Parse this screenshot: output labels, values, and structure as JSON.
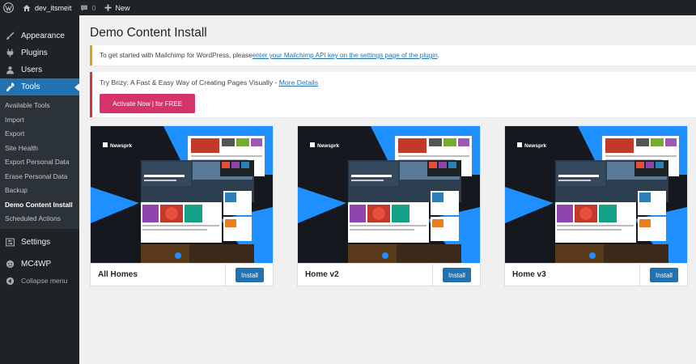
{
  "admin_bar": {
    "site_name": "dev_itsmeit",
    "comments_count": "0",
    "new_label": "New"
  },
  "sidebar": {
    "items_top": [
      {
        "label": "Appearance",
        "icon": "paintbrush-icon"
      },
      {
        "label": "Plugins",
        "icon": "plugin-icon"
      },
      {
        "label": "Users",
        "icon": "users-icon"
      }
    ],
    "current": {
      "label": "Tools",
      "icon": "wrench-icon"
    },
    "submenu": [
      "Available Tools",
      "Import",
      "Export",
      "Site Health",
      "Export Personal Data",
      "Erase Personal Data",
      "Backup",
      "Demo Content Install",
      "Scheduled Actions"
    ],
    "submenu_current": "Demo Content Install",
    "items_bottom": [
      {
        "label": "Settings",
        "icon": "settings-icon"
      },
      {
        "label": "MC4WP",
        "icon": "mc4wp-icon"
      },
      {
        "label": "Collapse menu",
        "icon": "collapse-icon"
      }
    ]
  },
  "page": {
    "title": "Demo Content Install"
  },
  "notices": {
    "mailchimp": {
      "text": "To get started with Mailchimp for WordPress, please ",
      "link": "enter your Mailchimp API key on the settings page of the plugin",
      "suffix": "."
    },
    "brizy": {
      "text": "Try Brizy: A Fast & Easy Way of Creating Pages Visually - ",
      "link": "More Details",
      "button": "Activate Now | for FREE"
    }
  },
  "demos": [
    {
      "name": "All Homes",
      "button": "Install",
      "logo": "Newsprk"
    },
    {
      "name": "Home v2",
      "button": "Install",
      "logo": "Newsprk"
    },
    {
      "name": "Home v3",
      "button": "Install",
      "logo": "Newsprk"
    }
  ],
  "colors": {
    "admin_dark": "#1d2327",
    "accent_blue": "#2271b1",
    "brizy_pink": "#d6336c",
    "thumb_blue": "#1e90ff"
  }
}
